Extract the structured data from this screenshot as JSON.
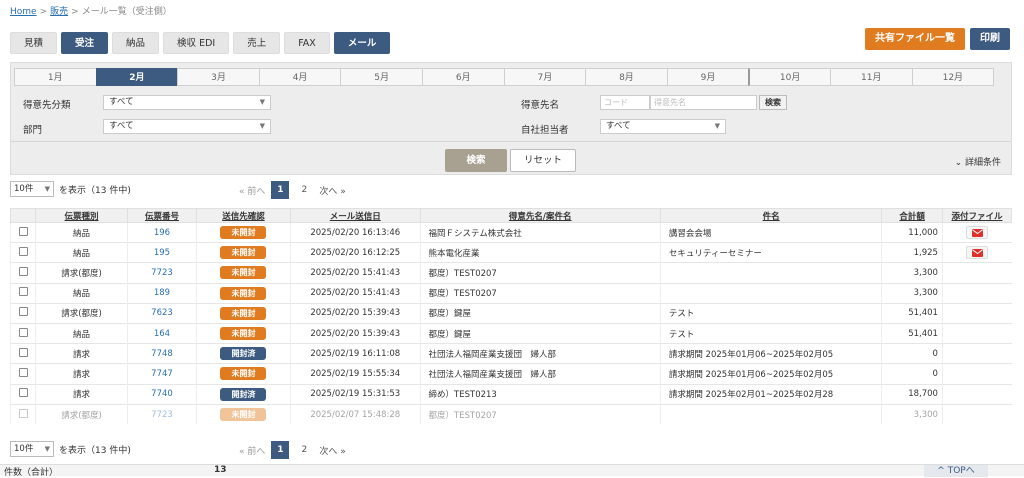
{
  "breadcrumb": {
    "home": "Home",
    "sep1": ">",
    "sales": "販売",
    "sep2": ">",
    "current": "メール一覧（受注側）"
  },
  "tabs": [
    {
      "label": "見積",
      "active": false
    },
    {
      "label": "受注",
      "active": true
    },
    {
      "label": "納品",
      "active": false
    },
    {
      "label": "検収 EDI",
      "active": false
    },
    {
      "label": "売上",
      "active": false
    },
    {
      "label": "FAX",
      "active": false
    },
    {
      "label": "メール",
      "active": true
    }
  ],
  "top_buttons": {
    "shared": "共有ファイル一覧",
    "print": "印刷"
  },
  "months": [
    "1月",
    "2月",
    "3月",
    "4月",
    "5月",
    "6月",
    "7月",
    "8月",
    "9月",
    "10月",
    "11月",
    "12月"
  ],
  "active_month": "2月",
  "filters": {
    "customer_category_label": "得意先分類",
    "customer_category_value": "すべて",
    "department_label": "部門",
    "department_value": "すべて",
    "customer_name_label": "得意先名",
    "customer_code_placeholder": "コード",
    "customer_name_placeholder": "得意先名",
    "lookup_button": "検索",
    "staff_label": "自社担当者",
    "staff_value": "すべて",
    "search_button": "検索",
    "reset_button": "リセット",
    "detail_label": "詳細条件"
  },
  "pagination": {
    "per_page": "10件",
    "summary": "を表示（13 件中)",
    "prev": "«  前へ",
    "pages": [
      "1",
      "2"
    ],
    "current": "1",
    "next": "次へ  »"
  },
  "table": {
    "headers": [
      "",
      "伝票種別",
      "伝票番号",
      "送信先確認",
      "メール送信日",
      "得意先名/案件名",
      "件名",
      "合計額",
      "添付ファイル"
    ],
    "rows": [
      {
        "type": "納品",
        "no": "196",
        "status": "未開封",
        "date": "2025/02/20 16:13:46",
        "customer": "福岡Ｆシステム株式会社",
        "subject": "講習会会場",
        "total": "11,000",
        "attach": true,
        "faded": false
      },
      {
        "type": "納品",
        "no": "195",
        "status": "未開封",
        "date": "2025/02/20 16:12:25",
        "customer": "熊本電化産業",
        "subject": "セキュリティーセミナー",
        "total": "1,925",
        "attach": true,
        "faded": false
      },
      {
        "type": "請求(都度)",
        "no": "7723",
        "status": "未開封",
        "date": "2025/02/20 15:41:43",
        "customer": "都度）TEST0207",
        "subject": "",
        "total": "3,300",
        "attach": false,
        "faded": false
      },
      {
        "type": "納品",
        "no": "189",
        "status": "未開封",
        "date": "2025/02/20 15:41:43",
        "customer": "都度）TEST0207",
        "subject": "",
        "total": "3,300",
        "attach": false,
        "faded": false
      },
      {
        "type": "請求(都度)",
        "no": "7623",
        "status": "未開封",
        "date": "2025/02/20 15:39:43",
        "customer": "都度）鍵屋",
        "subject": "テスト",
        "total": "51,401",
        "attach": false,
        "faded": false
      },
      {
        "type": "納品",
        "no": "164",
        "status": "未開封",
        "date": "2025/02/20 15:39:43",
        "customer": "都度）鍵屋",
        "subject": "テスト",
        "total": "51,401",
        "attach": false,
        "faded": false
      },
      {
        "type": "請求",
        "no": "7748",
        "status": "開封済",
        "date": "2025/02/19 16:11:08",
        "customer": "社団法人福岡産業支援団　婦人部",
        "subject": "請求期間 2025年01月06~2025年02月05",
        "total": "0",
        "attach": false,
        "faded": false
      },
      {
        "type": "請求",
        "no": "7747",
        "status": "未開封",
        "date": "2025/02/19 15:55:34",
        "customer": "社団法人福岡産業支援団　婦人部",
        "subject": "請求期間 2025年01月06~2025年02月05",
        "total": "0",
        "attach": false,
        "faded": false
      },
      {
        "type": "請求",
        "no": "7740",
        "status": "開封済",
        "date": "2025/02/19 15:31:53",
        "customer": "締め）TEST0213",
        "subject": "請求期間 2025年02月01~2025年02月28",
        "total": "18,700",
        "attach": false,
        "faded": false
      },
      {
        "type": "請求(都度)",
        "no": "7723",
        "status": "未開封",
        "date": "2025/02/07 15:48:28",
        "customer": "都度）TEST0207",
        "subject": "",
        "total": "3,300",
        "attach": false,
        "faded": true
      }
    ]
  },
  "footer": {
    "count_label": "件数（合計）",
    "count_value": "13",
    "top_link": "TOPへ"
  },
  "colors": {
    "navy": "#3d5a80",
    "unopened": "#e07b1f",
    "opened": "#3d5a80",
    "mail_red": "#e0302a"
  }
}
